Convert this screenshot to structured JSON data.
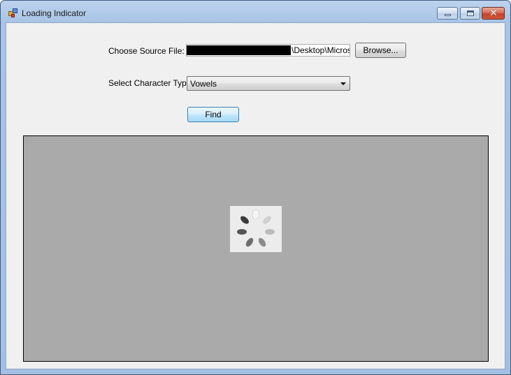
{
  "window": {
    "title": "Loading Indicator",
    "icon": "app-icon",
    "controls": {
      "minimize": "minimize-icon",
      "maximize": "maximize-icon",
      "close": "close-icon",
      "close_glyph": "✕"
    }
  },
  "form": {
    "source_label": "Choose Source File:",
    "source_value": "\\Desktop\\Microso",
    "browse_label": "Browse...",
    "char_type_label": "Select Character Type:",
    "char_type_value": "Vowels",
    "find_label": "Find"
  },
  "colors": {
    "panel_bg": "#aaaaaa",
    "client_bg": "#f0f0f0",
    "spinner_dark": "#3c3c3c",
    "spinner_light": "#c8c8c8"
  }
}
